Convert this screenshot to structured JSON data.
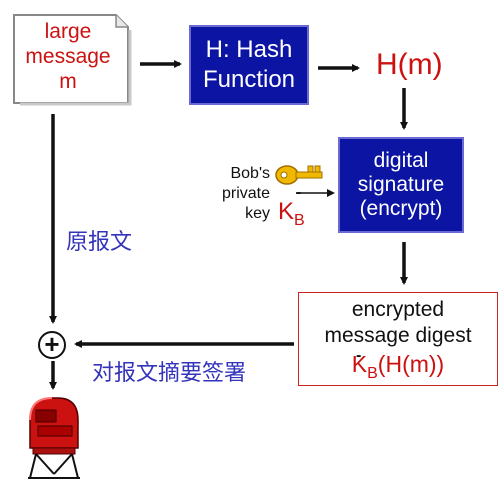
{
  "message": {
    "line1": "large",
    "line2": "message",
    "line3": "m"
  },
  "hash": {
    "line1": "H: Hash",
    "line2": "Function"
  },
  "hash_output": "H(m)",
  "signature": {
    "line1": "digital",
    "line2": "signature",
    "line3": "(encrypt)"
  },
  "key": {
    "line1": "Bob's",
    "line2": "private",
    "line3": "key",
    "symbol": "K",
    "subscript": "B",
    "mark": "-"
  },
  "digest": {
    "line1": "encrypted",
    "line2": "message digest",
    "symbol": "K",
    "subscript": "B",
    "mark": "-",
    "suffix": "(H(m))"
  },
  "original_label": "原报文",
  "signed_digest_label": "对报文摘要签署",
  "combine_symbol": "+",
  "colors": {
    "box_blue": "#0c14a4",
    "text_red": "#cc1111",
    "label_blue": "#3333bb"
  }
}
